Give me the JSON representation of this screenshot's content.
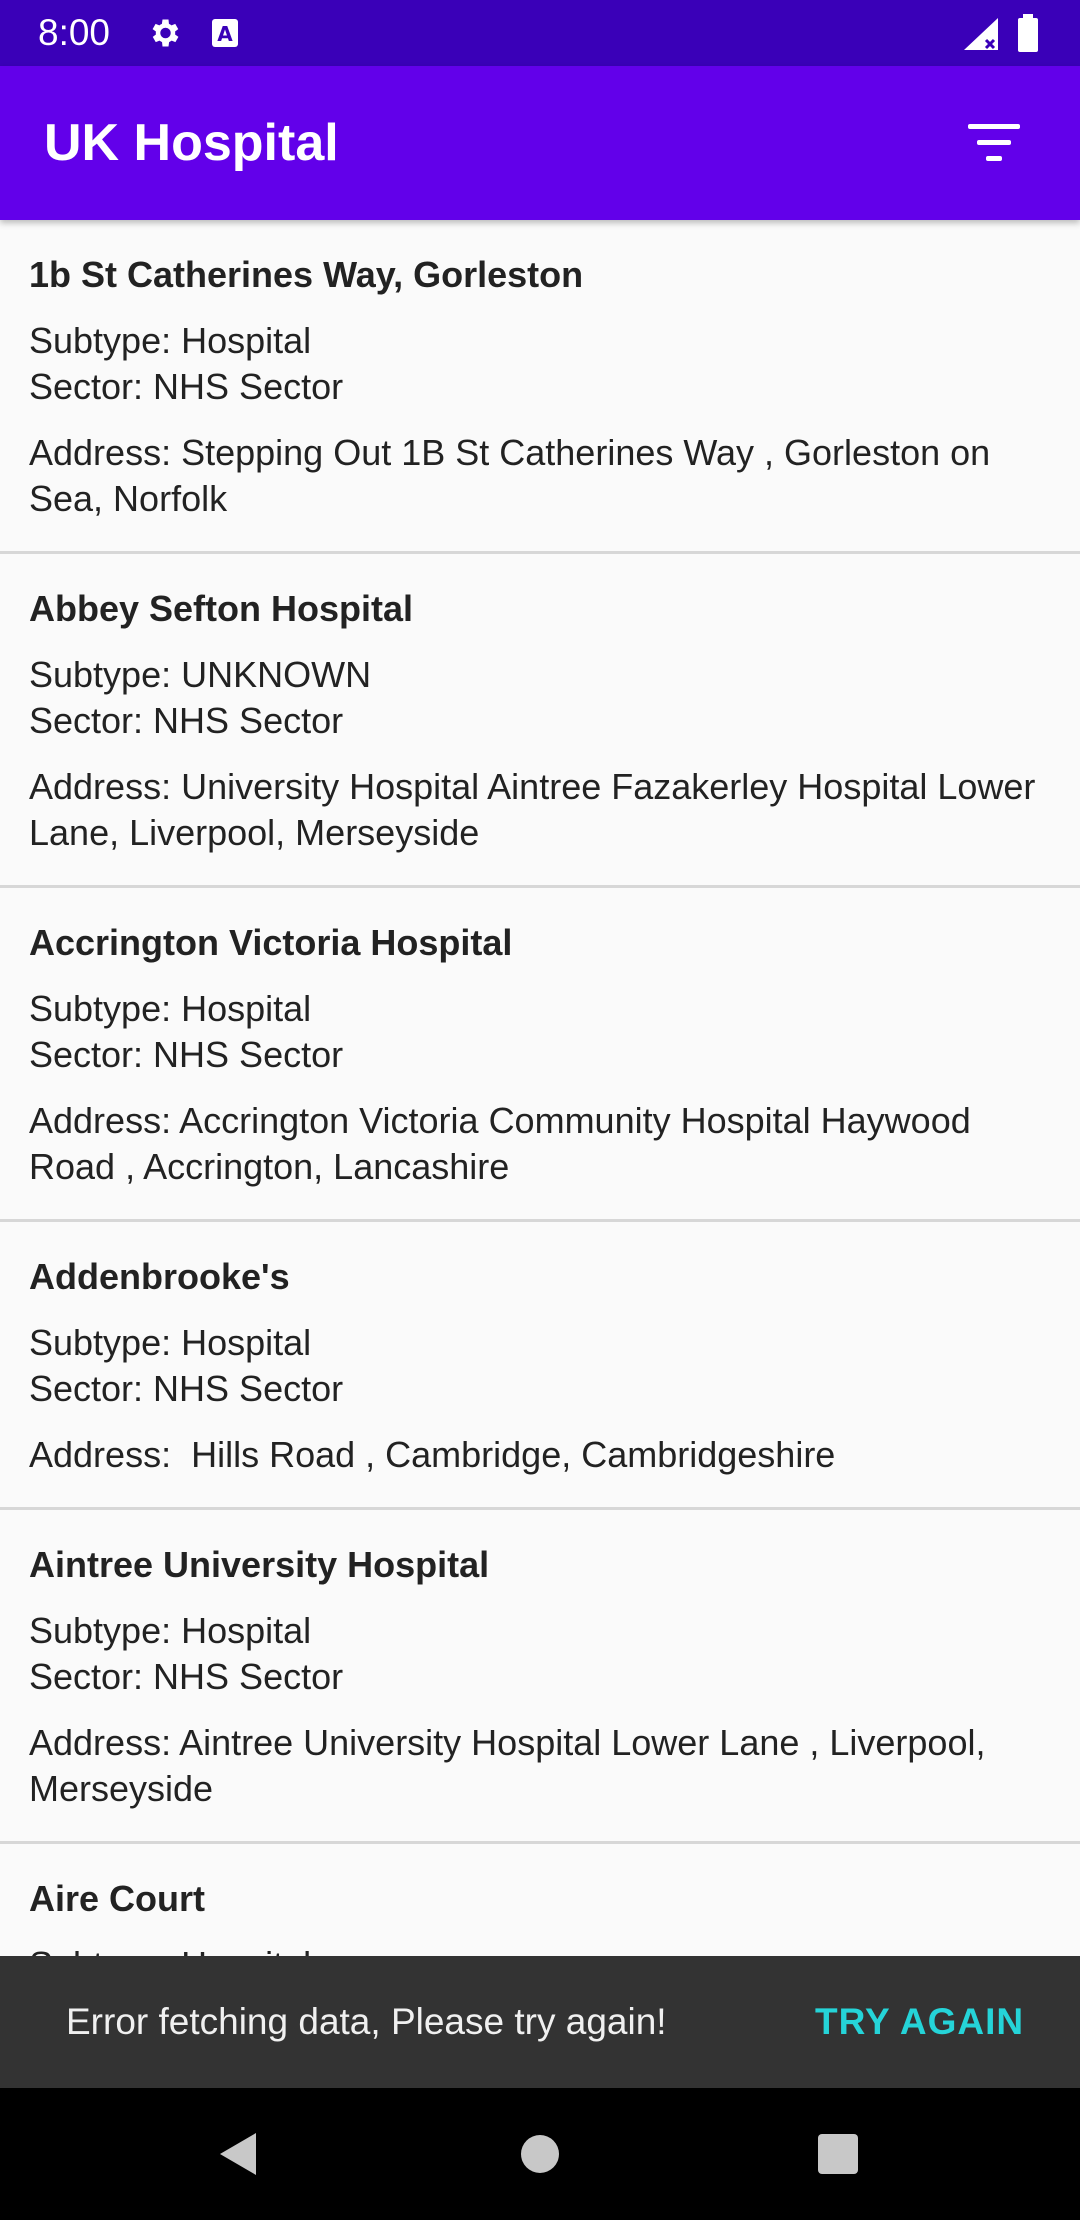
{
  "status_bar": {
    "time": "8:00",
    "icons": [
      "gear-icon",
      "keyboard-a-icon",
      "signal-icon",
      "battery-icon"
    ]
  },
  "app_bar": {
    "title": "UK Hospital",
    "filter_icon": "filter-icon"
  },
  "hospitals": [
    {
      "name": "1b St Catherines Way, Gorleston",
      "subtype": "Subtype: Hospital",
      "sector": "Sector: NHS Sector",
      "address": "Address: Stepping Out 1B St Catherines Way , Gorleston on Sea, Norfolk"
    },
    {
      "name": "Abbey Sefton Hospital",
      "subtype": "Subtype: UNKNOWN",
      "sector": "Sector: NHS Sector",
      "address": "Address: University Hospital Aintree Fazakerley Hospital Lower Lane, Liverpool, Merseyside"
    },
    {
      "name": "Accrington Victoria Hospital",
      "subtype": "Subtype: Hospital",
      "sector": "Sector: NHS Sector",
      "address": "Address: Accrington Victoria Community Hospital Haywood Road , Accrington, Lancashire"
    },
    {
      "name": "Addenbrooke's",
      "subtype": "Subtype: Hospital",
      "sector": "Sector: NHS Sector",
      "address": "Address:  Hills Road , Cambridge, Cambridgeshire"
    },
    {
      "name": "Aintree University Hospital",
      "subtype": "Subtype: Hospital",
      "sector": "Sector: NHS Sector",
      "address": "Address: Aintree University Hospital Lower Lane , Liverpool, Merseyside"
    },
    {
      "name": "Aire Court",
      "subtype": "Subtype: Hospital",
      "sector": "",
      "address": ""
    }
  ],
  "snackbar": {
    "message": "Error fetching data, Please try again!",
    "action": "TRY AGAIN"
  },
  "nav_bar": {
    "buttons": [
      "back-icon",
      "home-icon",
      "recents-icon"
    ]
  },
  "colors": {
    "status_bar": "#3a00b8",
    "app_bar": "#6200ea",
    "snackbar_bg": "#333333",
    "snackbar_action": "#25d4d8"
  }
}
